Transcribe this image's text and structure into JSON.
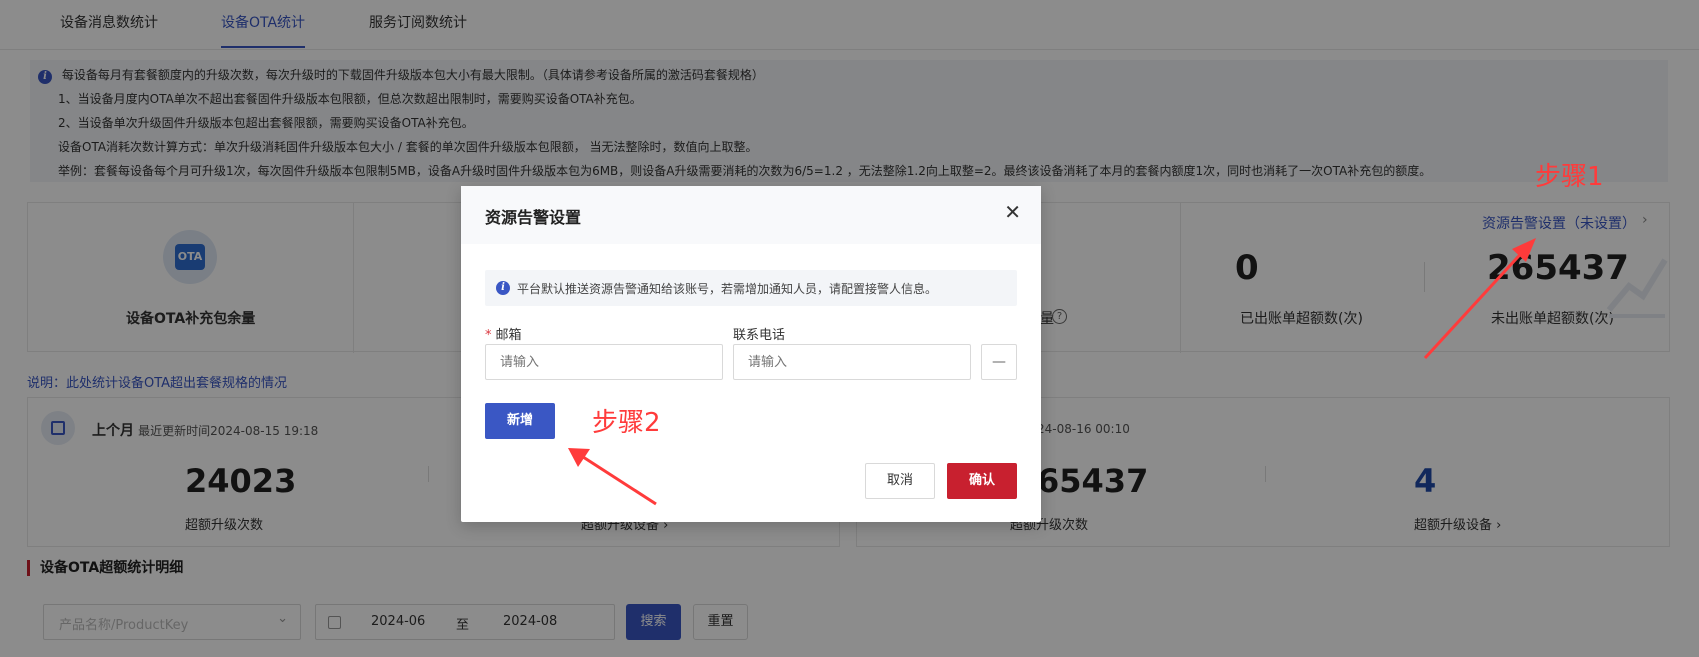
{
  "tabs": [
    {
      "label": "设备消息数统计"
    },
    {
      "label": "设备OTA统计"
    },
    {
      "label": "服务订阅数统计"
    }
  ],
  "info": {
    "lines": [
      "每设备每月有套餐额度内的升级次数，每次升级时的下载固件升级版本包大小有最大限制。（具体请参考设备所属的激活码套餐规格）",
      "1、当设备月度内OTA单次不超出套餐固件升级版本包限额，但总次数超出限制时，需要购买设备OTA补充包。",
      "2、当设备单次升级固件升级版本包超出套餐限额，需要购买设备OTA补充包。",
      "设备OTA消耗次数计算方式：单次升级消耗固件升级版本包大小 / 套餐的单次固件升级版本包限额， 当无法整除时，数值向上取整。",
      "举例：套餐每设备每个月可升级1次，每次固件升级版本包限制5MB，设备A升级时固件升级版本包为6MB，则设备A升级需要消耗的次数为6/5=1.2 ，无法整除1.2向上取整=2。最终该设备消耗了本月的套餐内额度1次，同时也消耗了一次OTA补充包的额度。"
    ]
  },
  "cards": {
    "ota_badge": "OTA",
    "ota_label": "设备OTA补充包余量",
    "partial_label": "量",
    "resource_link": "资源告警设置（未设置）",
    "billed_value": "0",
    "billed_label": "已出账单超额数(次)",
    "unbilled_value": "265437",
    "unbilled_label": "未出账单超额数(次)"
  },
  "note": "说明：此处统计设备OTA超出套餐规格的情况",
  "last_month": {
    "title": "上个月",
    "updated": "最近更新时间2024-08-15 19:18",
    "value": "24023",
    "label": "超额升级次数",
    "devices_label": "超额升级设备"
  },
  "this_month": {
    "updated_partial": "24-08-16 00:10",
    "value_partial": "65437",
    "label": "超额升级次数",
    "devices_value": "4",
    "devices_label": "超额升级设备"
  },
  "section_title": "设备OTA超额统计明细",
  "filter": {
    "product_placeholder": "产品名称/ProductKey",
    "date_start": "2024-06",
    "date_sep": "至",
    "date_end": "2024-08",
    "search_label": "搜索",
    "reset_label": "重置"
  },
  "modal": {
    "title": "资源告警设置",
    "notice": "平台默认推送资源告警通知给该账号，若需增加通知人员，请配置接警人信息。",
    "email_label": "邮箱",
    "email_placeholder": "请输入",
    "phone_label": "联系电话",
    "phone_placeholder": "请输入",
    "minus_label": "—",
    "add_label": "新增",
    "cancel_label": "取消",
    "confirm_label": "确认"
  },
  "annotations": {
    "step1": "步骤1",
    "step2": "步骤2"
  },
  "colors": {
    "primary": "#3a57c4",
    "danger": "#c8202f",
    "annotation": "#ff3b3b"
  }
}
